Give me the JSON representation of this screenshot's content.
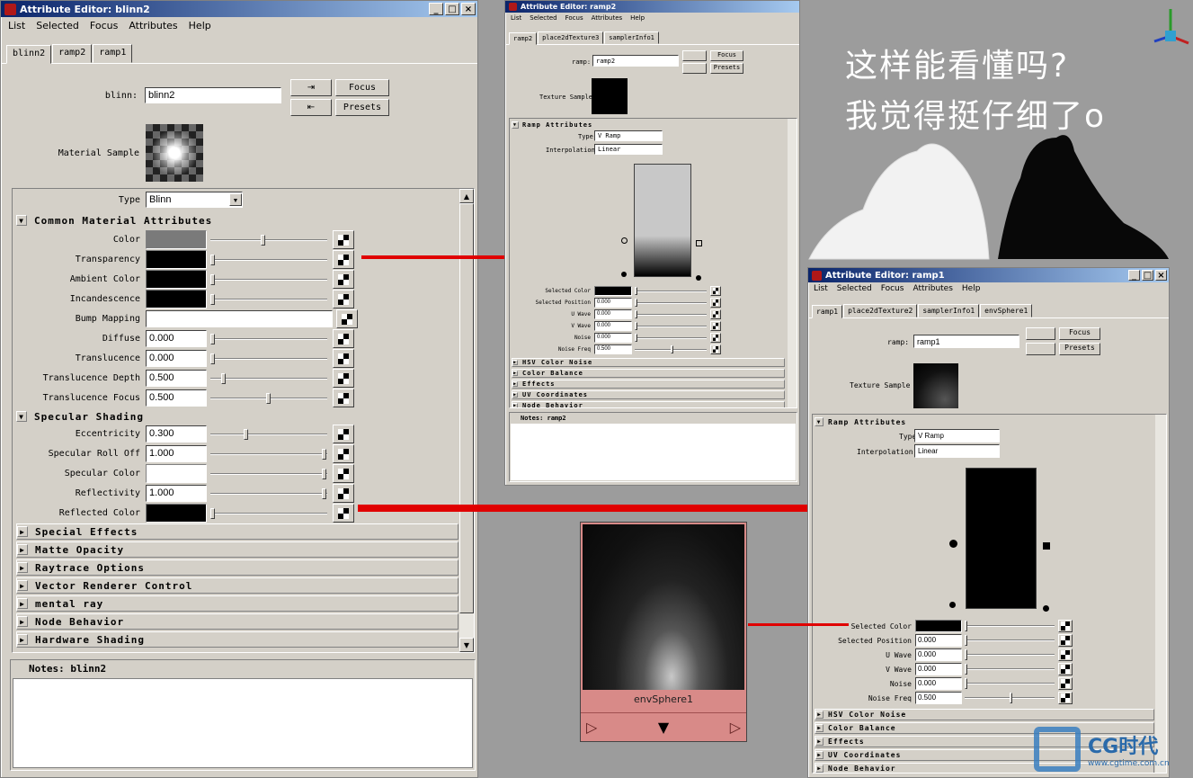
{
  "blinn_ed": {
    "title": "Attribute Editor: blinn2",
    "menu": [
      "List",
      "Selected",
      "Focus",
      "Attributes",
      "Help"
    ],
    "tabs": [
      "blinn2",
      "ramp2",
      "ramp1"
    ],
    "node_label": "blinn:",
    "node_value": "blinn2",
    "focus": "Focus",
    "presets": "Presets",
    "material_sample": "Material Sample",
    "type_label": "Type",
    "type_value": "Blinn",
    "common_hdr": "Common Material Attributes",
    "rows": [
      {
        "label": "Color",
        "kind": "swatch",
        "color": "#7a7a7a",
        "knob": 0.45
      },
      {
        "label": "Transparency",
        "kind": "swatch",
        "color": "#000000",
        "knob": 0.0
      },
      {
        "label": "Ambient Color",
        "kind": "swatch",
        "color": "#000000",
        "knob": 0.0
      },
      {
        "label": "Incandescence",
        "kind": "swatch",
        "color": "#000000",
        "knob": 0.0
      },
      {
        "label": "Bump Mapping",
        "kind": "field",
        "value": ""
      },
      {
        "label": "Diffuse",
        "kind": "num",
        "value": "0.000",
        "knob": 0.0
      },
      {
        "label": "Translucence",
        "kind": "num",
        "value": "0.000",
        "knob": 0.0
      },
      {
        "label": "Translucence Depth",
        "kind": "num",
        "value": "0.500",
        "knob": 0.1
      },
      {
        "label": "Translucence Focus",
        "kind": "num",
        "value": "0.500",
        "knob": 0.5
      }
    ],
    "spec_hdr": "Specular Shading",
    "spec_rows": [
      {
        "label": "Eccentricity",
        "kind": "num",
        "value": "0.300",
        "knob": 0.3
      },
      {
        "label": "Specular Roll Off",
        "kind": "num",
        "value": "1.000",
        "knob": 1.0
      },
      {
        "label": "Specular Color",
        "kind": "swatch",
        "color": "#ffffff",
        "knob": 1.0
      },
      {
        "label": "Reflectivity",
        "kind": "num",
        "value": "1.000",
        "knob": 1.0
      },
      {
        "label": "Reflected Color",
        "kind": "swatch",
        "color": "#000000",
        "knob": 0.0
      }
    ],
    "sections": [
      "Special Effects",
      "Matte Opacity",
      "Raytrace Options",
      "Vector Renderer Control",
      "mental ray",
      "Node Behavior",
      "Hardware Shading"
    ],
    "notes": "Notes:  blinn2"
  },
  "ramp2_ed": {
    "title": "Attribute Editor: ramp2",
    "menu": [
      "List",
      "Selected",
      "Focus",
      "Attributes",
      "Help"
    ],
    "tabs": [
      "ramp2",
      "place2dTexture3",
      "samplerInfo1"
    ],
    "node_label": "ramp:",
    "node_value": "ramp2",
    "focus": "Focus",
    "presets": "Presets",
    "texture_sample": "Texture Sample",
    "ramp_hdr": "Ramp Attributes",
    "type_label": "Type",
    "type_value": "V Ramp",
    "interp_label": "Interpolation",
    "interp_value": "Linear",
    "rows": [
      {
        "label": "Selected Color",
        "value": ""
      },
      {
        "label": "Selected Position",
        "value": "0.000"
      },
      {
        "label": "U Wave",
        "value": "0.000"
      },
      {
        "label": "V Wave",
        "value": "0.000"
      },
      {
        "label": "Noise",
        "value": "0.000"
      },
      {
        "label": "Noise Freq",
        "value": "0.500"
      }
    ],
    "sections": [
      "HSV Color Noise",
      "Color Balance",
      "Effects",
      "UV Coordinates",
      "Node Behavior"
    ],
    "notes": "Notes:  ramp2"
  },
  "ramp1_ed": {
    "title": "Attribute Editor: ramp1",
    "menu": [
      "List",
      "Selected",
      "Focus",
      "Attributes",
      "Help"
    ],
    "tabs": [
      "ramp1",
      "place2dTexture2",
      "samplerInfo1",
      "envSphere1"
    ],
    "node_label": "ramp:",
    "node_value": "ramp1",
    "focus": "Focus",
    "presets": "Presets",
    "texture_sample": "Texture Sample",
    "ramp_hdr": "Ramp Attributes",
    "type_label": "Type",
    "type_value": "V Ramp",
    "interp_label": "Interpolation",
    "interp_value": "Linear",
    "rows": [
      {
        "label": "Selected Color",
        "value": ""
      },
      {
        "label": "Selected Position",
        "value": "0.000"
      },
      {
        "label": "U Wave",
        "value": "0.000"
      },
      {
        "label": "V Wave",
        "value": "0.000"
      },
      {
        "label": "Noise",
        "value": "0.000"
      },
      {
        "label": "Noise Freq",
        "value": "0.500"
      }
    ],
    "sections": [
      "HSV Color Noise",
      "Color Balance",
      "Effects",
      "UV Coordinates",
      "Node Behavior"
    ]
  },
  "env_node": {
    "label": "envSphere1"
  },
  "handwriting": {
    "line1": "这样能看懂吗?",
    "line2": "我觉得挺仔细了o"
  },
  "watermark": {
    "brand": "CG时代",
    "url": "www.cgtime.com.cn"
  }
}
